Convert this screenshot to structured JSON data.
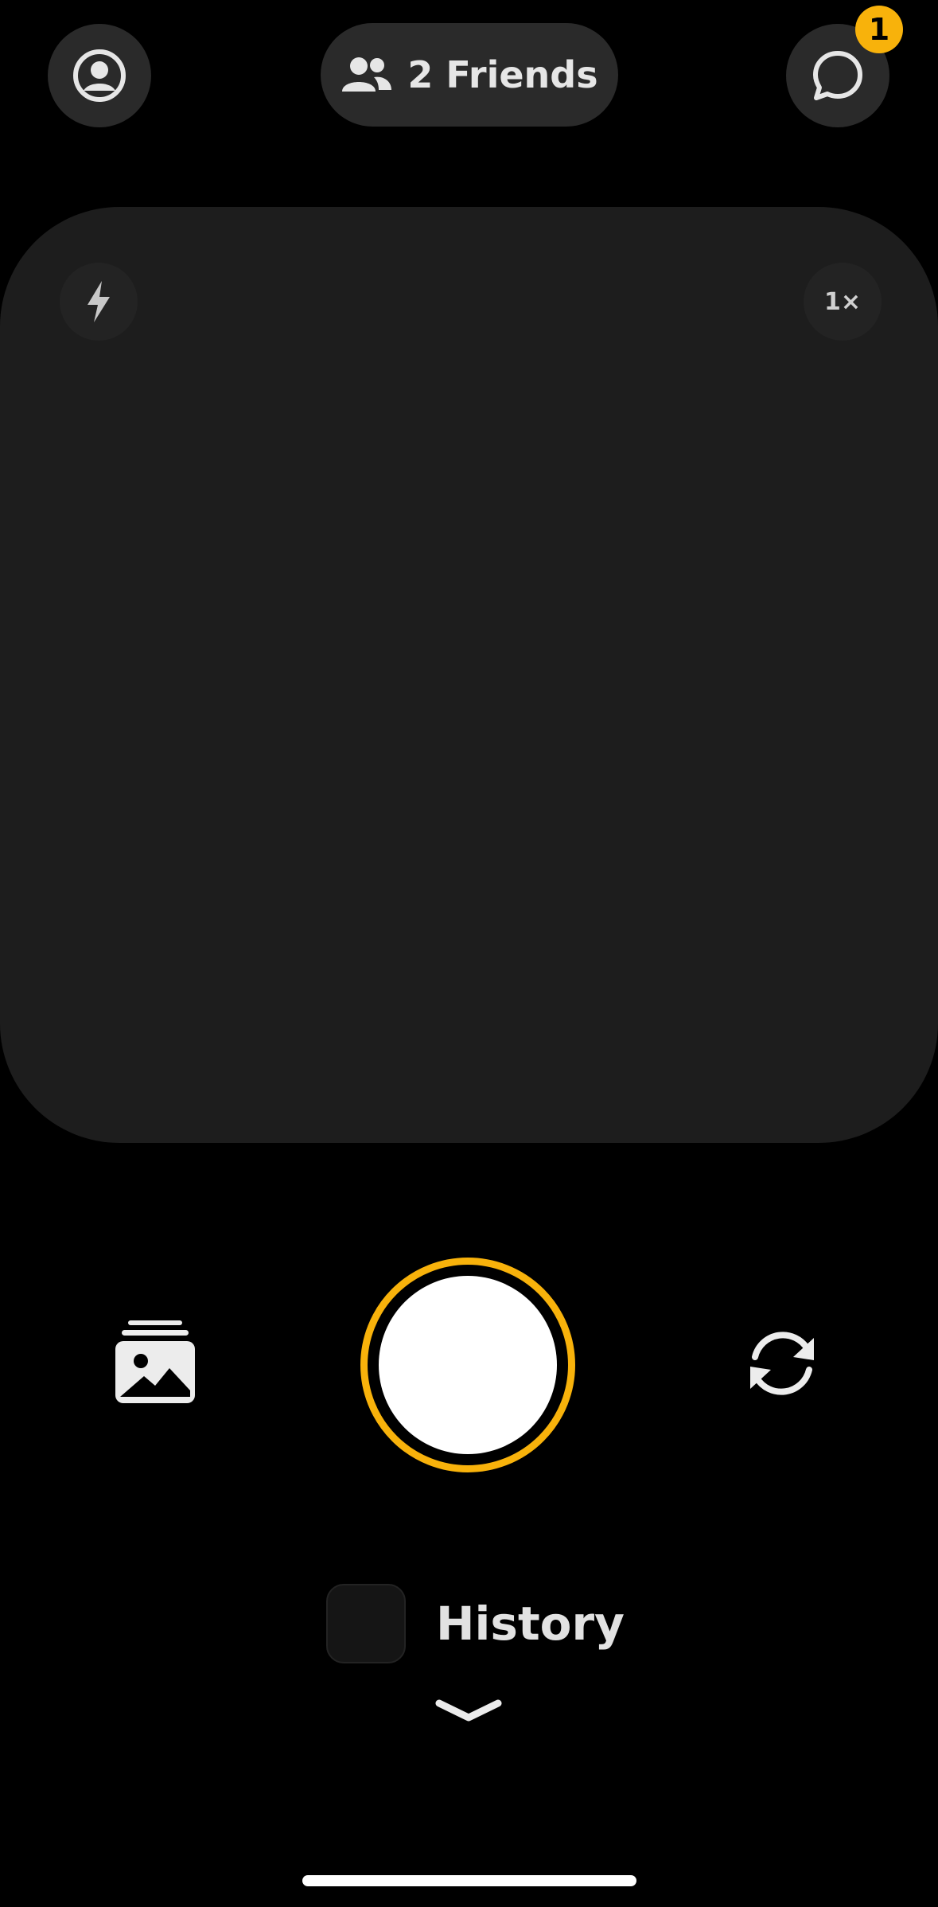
{
  "header": {
    "profile_icon": "person-circle-icon",
    "friends_icon": "two-people-icon",
    "friends_label": "2 Friends",
    "chat_icon": "chat-bubble-icon",
    "chat_badge": "1"
  },
  "camera": {
    "flash_icon": "lightning-bolt-icon",
    "zoom_label": "1×"
  },
  "controls": {
    "gallery_icon": "photo-stack-icon",
    "shutter_icon": "shutter-button",
    "flip_icon": "camera-flip-icon"
  },
  "history": {
    "label": "History",
    "chevron_icon": "chevron-down-icon"
  },
  "colors": {
    "accent": "#f8b20b",
    "background": "#000000",
    "surface": "#2a2a2a",
    "viewfinder": "#1d1d1d"
  }
}
